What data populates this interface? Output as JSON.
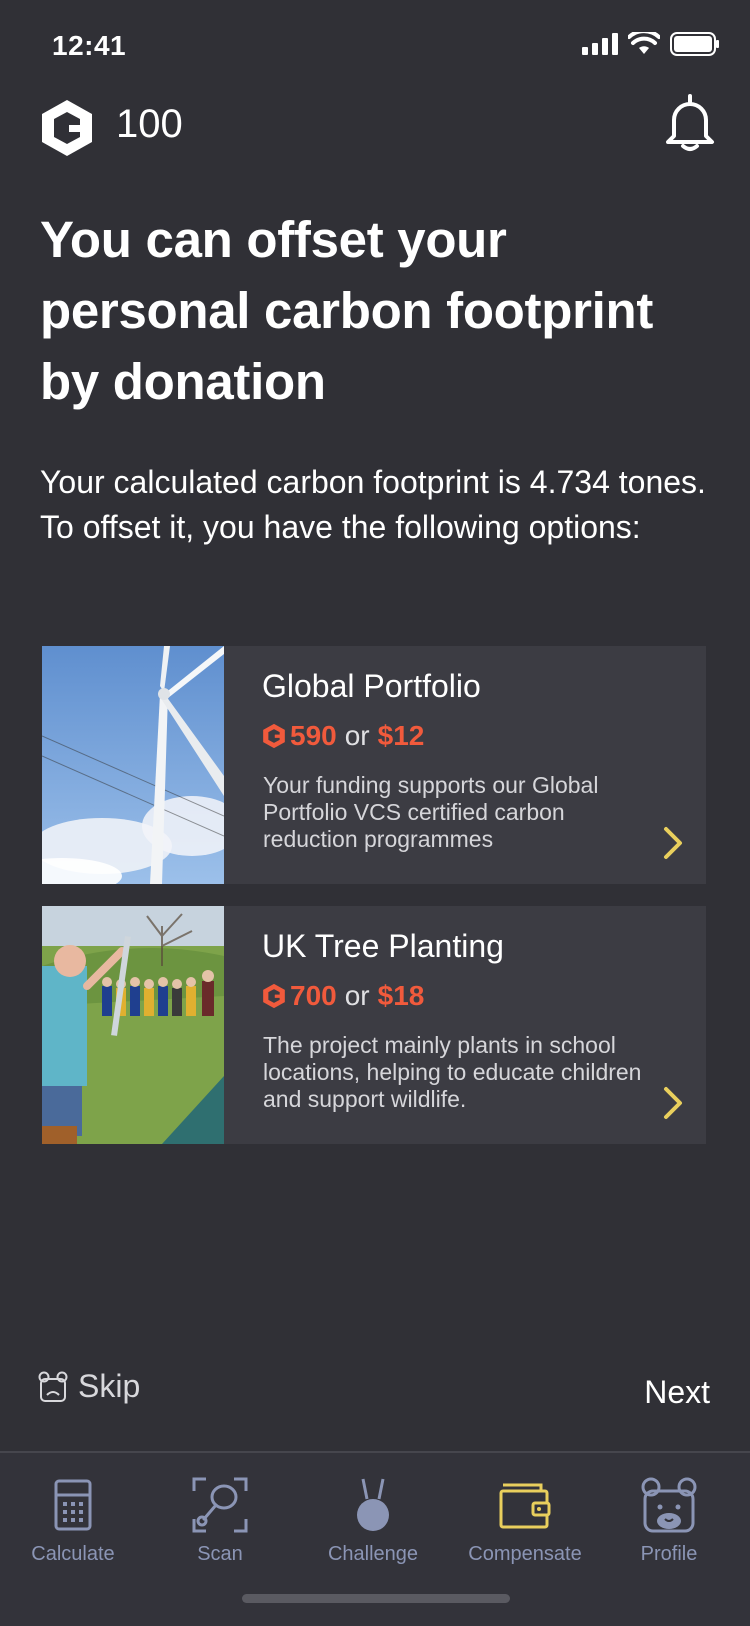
{
  "status": {
    "time": "12:41"
  },
  "header": {
    "points": "100"
  },
  "headline": "You can offset your personal carbon footprint by donation",
  "intro": "Your calculated carbon footprint is 4.734 tones. To offset it, you have the following options:",
  "offers": [
    {
      "title": "Global Portfolio",
      "coins": "590",
      "or": "or",
      "cash": "$12",
      "description": "Your funding supports our Global Portfolio VCS certified carbon reduction programmes"
    },
    {
      "title": "UK Tree Planting",
      "coins": "700",
      "or": "or",
      "cash": "$18",
      "description": "The project mainly plants in school locations, helping to educate children and support wildlife."
    }
  ],
  "footer": {
    "skip_label": "Skip",
    "next_label": "Next"
  },
  "tabs": [
    {
      "label": "Calculate",
      "icon": "calculator-icon"
    },
    {
      "label": "Scan",
      "icon": "scan-icon"
    },
    {
      "label": "Challenge",
      "icon": "medal-icon"
    },
    {
      "label": "Compensate",
      "icon": "wallet-icon",
      "active": true
    },
    {
      "label": "Profile",
      "icon": "bear-profile-icon"
    }
  ],
  "colors": {
    "background": "#303036",
    "accent_orange": "#f15a3c",
    "accent_yellow": "#e9cf5d",
    "tab_inactive": "#8b95b5"
  }
}
